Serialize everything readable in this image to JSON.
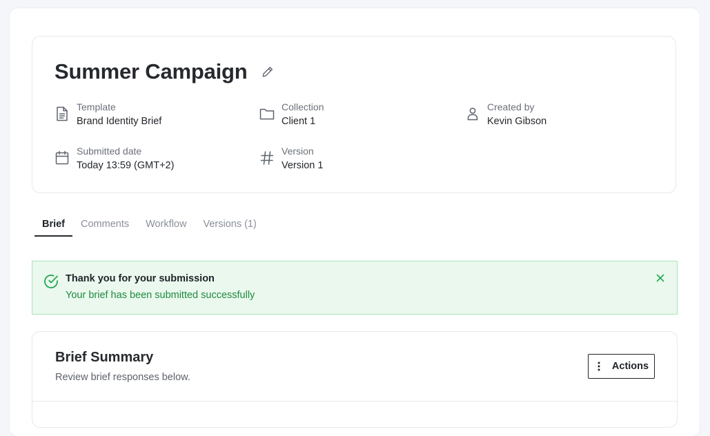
{
  "header": {
    "title": "Summer Campaign",
    "meta": {
      "template": {
        "label": "Template",
        "value": "Brand Identity Brief"
      },
      "collection": {
        "label": "Collection",
        "value": "Client 1"
      },
      "created_by": {
        "label": "Created by",
        "value": "Kevin Gibson"
      },
      "submitted_date": {
        "label": "Submitted date",
        "value": "Today 13:59 (GMT+2)"
      },
      "version": {
        "label": "Version",
        "value": "Version 1"
      }
    }
  },
  "icons": {
    "edit": "pencil-icon",
    "template": "document-icon",
    "collection": "folder-icon",
    "created_by": "user-icon",
    "submitted_date": "calendar-icon",
    "version": "hash-icon",
    "success": "check-circle-icon",
    "close": "close-icon",
    "actions": "more-vertical-icon"
  },
  "tabs": [
    {
      "label": "Brief",
      "active": true
    },
    {
      "label": "Comments",
      "active": false
    },
    {
      "label": "Workflow",
      "active": false
    },
    {
      "label": "Versions (1)",
      "active": false
    }
  ],
  "alert": {
    "title": "Thank you for your submission",
    "message": "Your brief has been submitted successfully"
  },
  "summary": {
    "title": "Brief Summary",
    "subtitle": "Review brief responses below.",
    "actions_label": "Actions"
  },
  "colors": {
    "success_bg": "#eaf8ee",
    "success_border": "#a9e4bb",
    "success_text": "#1f8a3d",
    "success_icon": "#22a84f",
    "text_dark": "#1f2328",
    "text_muted": "#6b7079"
  }
}
